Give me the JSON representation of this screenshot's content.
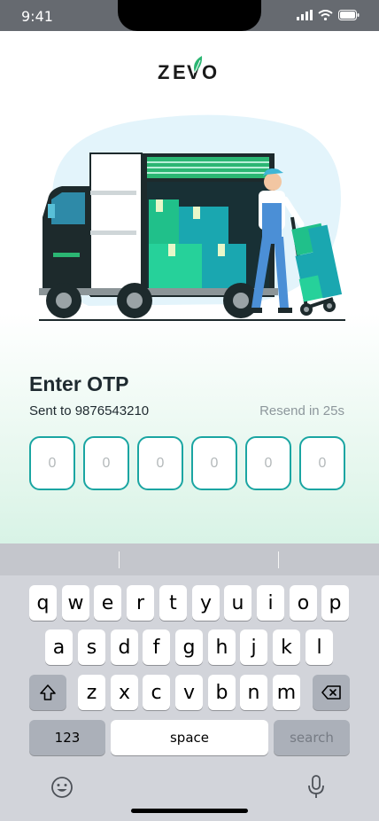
{
  "status": {
    "time": "9:41"
  },
  "brand": {
    "logo_text": "ZEVO",
    "accent": "#2bb673",
    "dark": "#1a1a1a"
  },
  "otp": {
    "title": "Enter OTP",
    "sent_to": "Sent to 9876543210",
    "resend": "Resend in 25s",
    "digits": [
      "0",
      "0",
      "0",
      "0",
      "0",
      "0"
    ]
  },
  "keyboard": {
    "row1": [
      "q",
      "w",
      "e",
      "r",
      "t",
      "y",
      "u",
      "i",
      "o",
      "p"
    ],
    "row2": [
      "a",
      "s",
      "d",
      "f",
      "g",
      "h",
      "j",
      "k",
      "l"
    ],
    "row3": [
      "z",
      "x",
      "c",
      "v",
      "b",
      "n",
      "m"
    ],
    "numbers_label": "123",
    "space_label": "space",
    "search_label": "search"
  },
  "icons": [
    "signal-icon",
    "wifi-icon",
    "battery-icon",
    "shift-icon",
    "backspace-icon",
    "emoji-icon",
    "microphone-icon"
  ]
}
